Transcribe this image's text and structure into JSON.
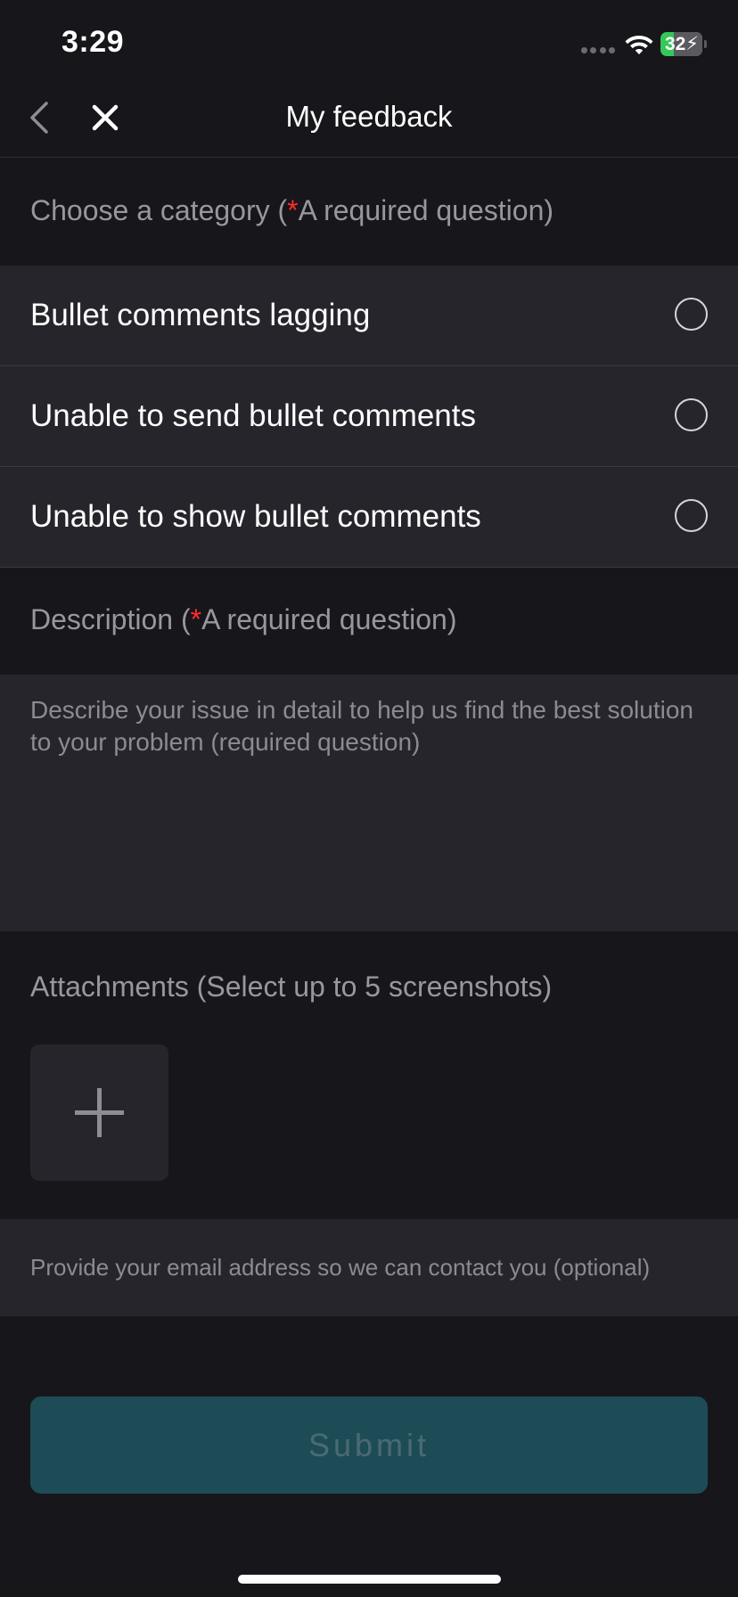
{
  "status_bar": {
    "time": "3:29",
    "battery_level": "32",
    "battery_fraction": 0.32,
    "charging": true,
    "icons": [
      "signal-dots-icon",
      "wifi-icon",
      "battery-charging-icon"
    ]
  },
  "nav": {
    "title": "My feedback",
    "back_icon": "chevron-left-icon",
    "close_icon": "close-icon"
  },
  "category": {
    "label": "Choose a category (",
    "required_star": "*",
    "required_text": "A required question)",
    "options": [
      {
        "label": "Bullet comments lagging",
        "selected": false
      },
      {
        "label": "Unable to send bullet comments",
        "selected": false
      },
      {
        "label": "Unable to show bullet comments",
        "selected": false
      }
    ]
  },
  "description": {
    "label": "Description (",
    "required_star": "*",
    "required_text": "A required question)",
    "value": "",
    "placeholder": "Describe your issue in detail to help us find the best solution to your problem (required question)"
  },
  "attachments": {
    "label": "Attachments (Select up to 5 screenshots)",
    "add_icon": "plus-icon"
  },
  "email": {
    "value": "",
    "placeholder": "Provide your email address so we can contact you (optional)"
  },
  "submit": {
    "label": "Submit",
    "enabled": false
  },
  "colors": {
    "background": "#17161b",
    "panel": "#26252b",
    "required_star": "#ff2d2d",
    "submit_bg": "#1d4c57",
    "battery_green": "#34c759"
  }
}
